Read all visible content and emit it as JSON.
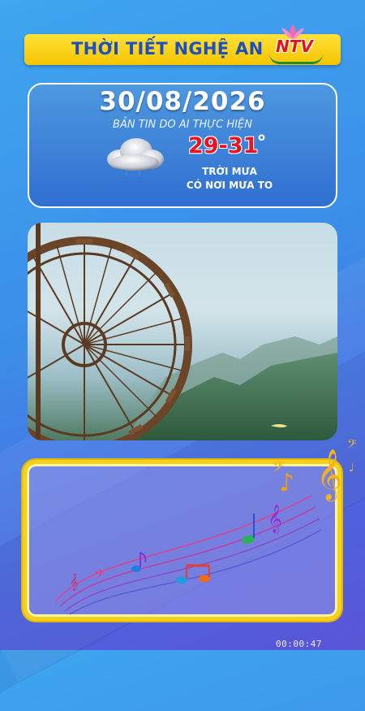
{
  "header": {
    "title": "THỜI TIẾT NGHỆ AN",
    "logo_text": "NTV"
  },
  "forecast": {
    "date": "30/08/2026",
    "subtitle": "BẢN TIN DO AI THỰC HIỆN",
    "temperature": "29-31",
    "degree_symbol": "o",
    "condition_line1": "TRỜI MƯA",
    "condition_line2": "CÓ NƠI MƯA TO",
    "icon": "rain-cloud-icon"
  },
  "media": {
    "photo_icon": "water-wheel-landscape-image",
    "decoration_icon": "music-notes-icon"
  },
  "colors": {
    "accent_yellow": "#f5c400",
    "title_blue": "#1d4fc0",
    "temp_red": "#e8141f",
    "brand_red": "#e0161e"
  },
  "player": {
    "timestamp": "00:00:47"
  }
}
